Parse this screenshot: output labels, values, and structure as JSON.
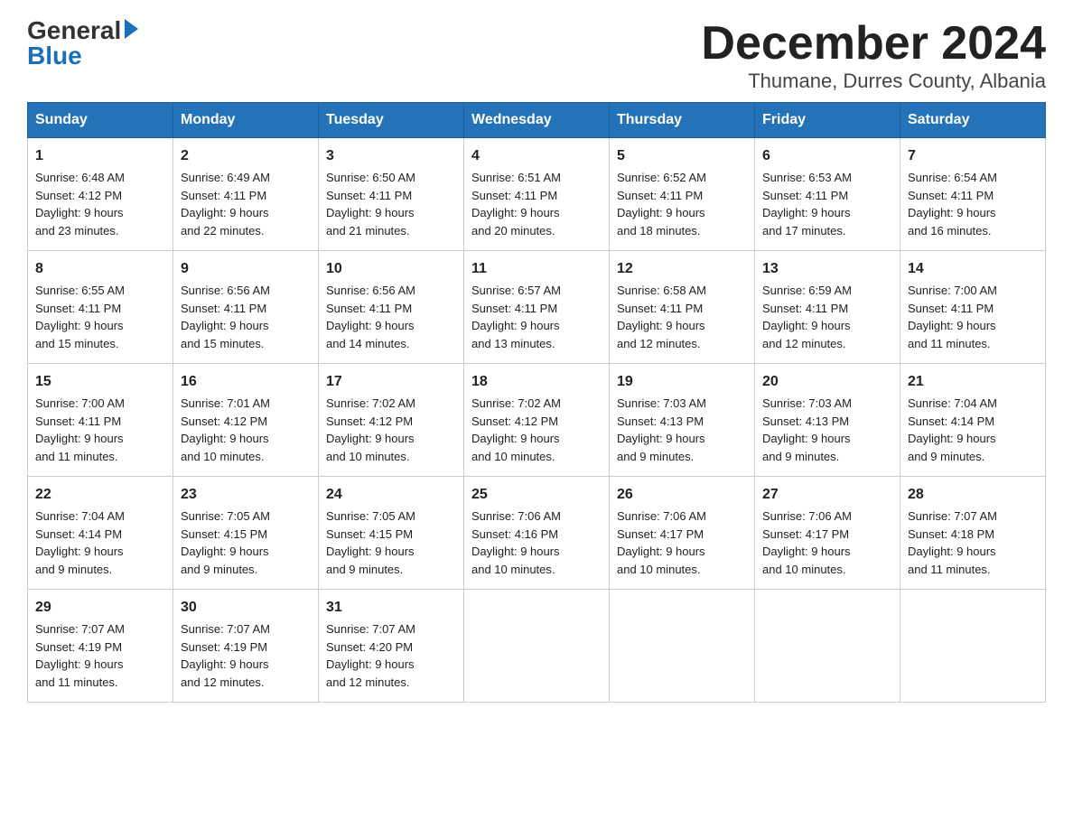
{
  "header": {
    "logo": {
      "general": "General",
      "blue": "Blue",
      "arrow": "▶"
    },
    "title": "December 2024",
    "location": "Thumane, Durres County, Albania"
  },
  "days_of_week": [
    "Sunday",
    "Monday",
    "Tuesday",
    "Wednesday",
    "Thursday",
    "Friday",
    "Saturday"
  ],
  "weeks": [
    [
      {
        "day": "1",
        "sunrise": "6:48 AM",
        "sunset": "4:12 PM",
        "daylight": "9 hours and 23 minutes."
      },
      {
        "day": "2",
        "sunrise": "6:49 AM",
        "sunset": "4:11 PM",
        "daylight": "9 hours and 22 minutes."
      },
      {
        "day": "3",
        "sunrise": "6:50 AM",
        "sunset": "4:11 PM",
        "daylight": "9 hours and 21 minutes."
      },
      {
        "day": "4",
        "sunrise": "6:51 AM",
        "sunset": "4:11 PM",
        "daylight": "9 hours and 20 minutes."
      },
      {
        "day": "5",
        "sunrise": "6:52 AM",
        "sunset": "4:11 PM",
        "daylight": "9 hours and 18 minutes."
      },
      {
        "day": "6",
        "sunrise": "6:53 AM",
        "sunset": "4:11 PM",
        "daylight": "9 hours and 17 minutes."
      },
      {
        "day": "7",
        "sunrise": "6:54 AM",
        "sunset": "4:11 PM",
        "daylight": "9 hours and 16 minutes."
      }
    ],
    [
      {
        "day": "8",
        "sunrise": "6:55 AM",
        "sunset": "4:11 PM",
        "daylight": "9 hours and 15 minutes."
      },
      {
        "day": "9",
        "sunrise": "6:56 AM",
        "sunset": "4:11 PM",
        "daylight": "9 hours and 15 minutes."
      },
      {
        "day": "10",
        "sunrise": "6:56 AM",
        "sunset": "4:11 PM",
        "daylight": "9 hours and 14 minutes."
      },
      {
        "day": "11",
        "sunrise": "6:57 AM",
        "sunset": "4:11 PM",
        "daylight": "9 hours and 13 minutes."
      },
      {
        "day": "12",
        "sunrise": "6:58 AM",
        "sunset": "4:11 PM",
        "daylight": "9 hours and 12 minutes."
      },
      {
        "day": "13",
        "sunrise": "6:59 AM",
        "sunset": "4:11 PM",
        "daylight": "9 hours and 12 minutes."
      },
      {
        "day": "14",
        "sunrise": "7:00 AM",
        "sunset": "4:11 PM",
        "daylight": "9 hours and 11 minutes."
      }
    ],
    [
      {
        "day": "15",
        "sunrise": "7:00 AM",
        "sunset": "4:11 PM",
        "daylight": "9 hours and 11 minutes."
      },
      {
        "day": "16",
        "sunrise": "7:01 AM",
        "sunset": "4:12 PM",
        "daylight": "9 hours and 10 minutes."
      },
      {
        "day": "17",
        "sunrise": "7:02 AM",
        "sunset": "4:12 PM",
        "daylight": "9 hours and 10 minutes."
      },
      {
        "day": "18",
        "sunrise": "7:02 AM",
        "sunset": "4:12 PM",
        "daylight": "9 hours and 10 minutes."
      },
      {
        "day": "19",
        "sunrise": "7:03 AM",
        "sunset": "4:13 PM",
        "daylight": "9 hours and 9 minutes."
      },
      {
        "day": "20",
        "sunrise": "7:03 AM",
        "sunset": "4:13 PM",
        "daylight": "9 hours and 9 minutes."
      },
      {
        "day": "21",
        "sunrise": "7:04 AM",
        "sunset": "4:14 PM",
        "daylight": "9 hours and 9 minutes."
      }
    ],
    [
      {
        "day": "22",
        "sunrise": "7:04 AM",
        "sunset": "4:14 PM",
        "daylight": "9 hours and 9 minutes."
      },
      {
        "day": "23",
        "sunrise": "7:05 AM",
        "sunset": "4:15 PM",
        "daylight": "9 hours and 9 minutes."
      },
      {
        "day": "24",
        "sunrise": "7:05 AM",
        "sunset": "4:15 PM",
        "daylight": "9 hours and 9 minutes."
      },
      {
        "day": "25",
        "sunrise": "7:06 AM",
        "sunset": "4:16 PM",
        "daylight": "9 hours and 10 minutes."
      },
      {
        "day": "26",
        "sunrise": "7:06 AM",
        "sunset": "4:17 PM",
        "daylight": "9 hours and 10 minutes."
      },
      {
        "day": "27",
        "sunrise": "7:06 AM",
        "sunset": "4:17 PM",
        "daylight": "9 hours and 10 minutes."
      },
      {
        "day": "28",
        "sunrise": "7:07 AM",
        "sunset": "4:18 PM",
        "daylight": "9 hours and 11 minutes."
      }
    ],
    [
      {
        "day": "29",
        "sunrise": "7:07 AM",
        "sunset": "4:19 PM",
        "daylight": "9 hours and 11 minutes."
      },
      {
        "day": "30",
        "sunrise": "7:07 AM",
        "sunset": "4:19 PM",
        "daylight": "9 hours and 12 minutes."
      },
      {
        "day": "31",
        "sunrise": "7:07 AM",
        "sunset": "4:20 PM",
        "daylight": "9 hours and 12 minutes."
      },
      null,
      null,
      null,
      null
    ]
  ],
  "labels": {
    "sunrise": "Sunrise:",
    "sunset": "Sunset:",
    "daylight": "Daylight:"
  }
}
